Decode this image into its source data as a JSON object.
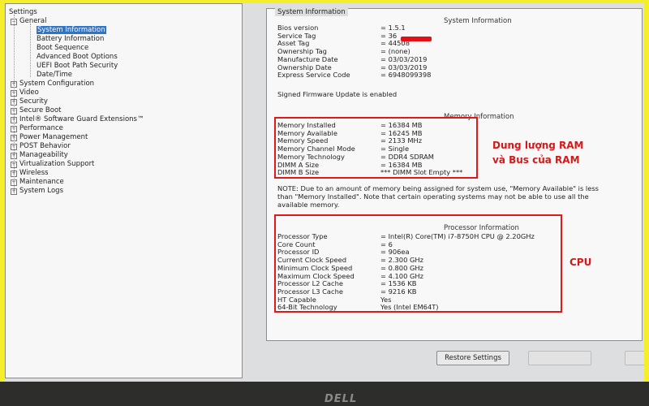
{
  "tree": {
    "title": "Settings",
    "items": [
      {
        "label": "General",
        "level": 1,
        "expander": "−"
      },
      {
        "label": "System Information",
        "level": 2,
        "selected": true
      },
      {
        "label": "Battery Information",
        "level": 2
      },
      {
        "label": "Boot Sequence",
        "level": 2
      },
      {
        "label": "Advanced Boot Options",
        "level": 2
      },
      {
        "label": "UEFI Boot Path Security",
        "level": 2
      },
      {
        "label": "Date/Time",
        "level": 2
      },
      {
        "label": "System Configuration",
        "level": 1,
        "expander": "+"
      },
      {
        "label": "Video",
        "level": 1,
        "expander": "+"
      },
      {
        "label": "Security",
        "level": 1,
        "expander": "+"
      },
      {
        "label": "Secure Boot",
        "level": 1,
        "expander": "+"
      },
      {
        "label": "Intel® Software Guard Extensions™",
        "level": 1,
        "expander": "+"
      },
      {
        "label": "Performance",
        "level": 1,
        "expander": "+"
      },
      {
        "label": "Power Management",
        "level": 1,
        "expander": "+"
      },
      {
        "label": "POST Behavior",
        "level": 1,
        "expander": "+"
      },
      {
        "label": "Manageability",
        "level": 1,
        "expander": "+"
      },
      {
        "label": "Virtualization Support",
        "level": 1,
        "expander": "+"
      },
      {
        "label": "Wireless",
        "level": 1,
        "expander": "+"
      },
      {
        "label": "Maintenance",
        "level": 1,
        "expander": "+"
      },
      {
        "label": "System Logs",
        "level": 1,
        "expander": "+"
      }
    ]
  },
  "info": {
    "group_title": "System Information",
    "system_header": "System Information",
    "system": [
      {
        "key": "Bios version",
        "value": "= 1.5.1"
      },
      {
        "key": "Service Tag",
        "value": "= 36"
      },
      {
        "key": "Asset Tag",
        "value": "= 44508"
      },
      {
        "key": "Ownership Tag",
        "value": "= (none)"
      },
      {
        "key": "Manufacture Date",
        "value": "= 03/03/2019"
      },
      {
        "key": "Ownership Date",
        "value": "= 03/03/2019"
      },
      {
        "key": "Express Service Code",
        "value": "= 6948099398"
      }
    ],
    "firmware_note": "Signed Firmware Update is enabled",
    "memory_header": "Memory Information",
    "memory": [
      {
        "key": "Memory Installed",
        "value": "= 16384 MB"
      },
      {
        "key": "Memory Available",
        "value": "= 16245 MB"
      },
      {
        "key": "Memory Speed",
        "value": "= 2133 MHz"
      },
      {
        "key": "Memory Channel Mode",
        "value": "= Single"
      },
      {
        "key": "Memory Technology",
        "value": "= DDR4 SDRAM"
      },
      {
        "key": "DIMM A Size",
        "value": "= 16384 MB"
      },
      {
        "key": "DIMM B Size",
        "value": "*** DIMM Slot Empty ***"
      }
    ],
    "note_lines": [
      "NOTE: Due to an amount of memory being assigned for system use, \"Memory Available\" is less",
      "than \"Memory Installed\". Note that certain operating systems may not be able to use all the",
      "available memory."
    ],
    "processor_header": "Processor Information",
    "processor": [
      {
        "key": "Processor Type",
        "value": "= Intel(R) Core(TM) i7-8750H CPU @ 2.20GHz"
      },
      {
        "key": "Core Count",
        "value": "= 6"
      },
      {
        "key": "Processor ID",
        "value": "= 906ea"
      },
      {
        "key": "Current Clock Speed",
        "value": "= 2.300 GHz"
      },
      {
        "key": "Minimum Clock Speed",
        "value": "= 0.800 GHz"
      },
      {
        "key": "Maximum Clock Speed",
        "value": "= 4.100 GHz"
      },
      {
        "key": "Processor L2 Cache",
        "value": "= 1536 KB"
      },
      {
        "key": "Processor L3 Cache",
        "value": "= 9216 KB"
      },
      {
        "key": "HT Capable",
        "value": "Yes"
      },
      {
        "key": "64-Bit Technology",
        "value": "Yes (Intel EM64T)"
      }
    ]
  },
  "annotations": {
    "ram_line1": "Dung lượng RAM",
    "ram_line2": "và Bus  của RAM",
    "cpu": "CPU",
    "color": "#e01a1a"
  },
  "buttons": {
    "restore": "Restore Settings"
  },
  "logo_text": "DELL"
}
